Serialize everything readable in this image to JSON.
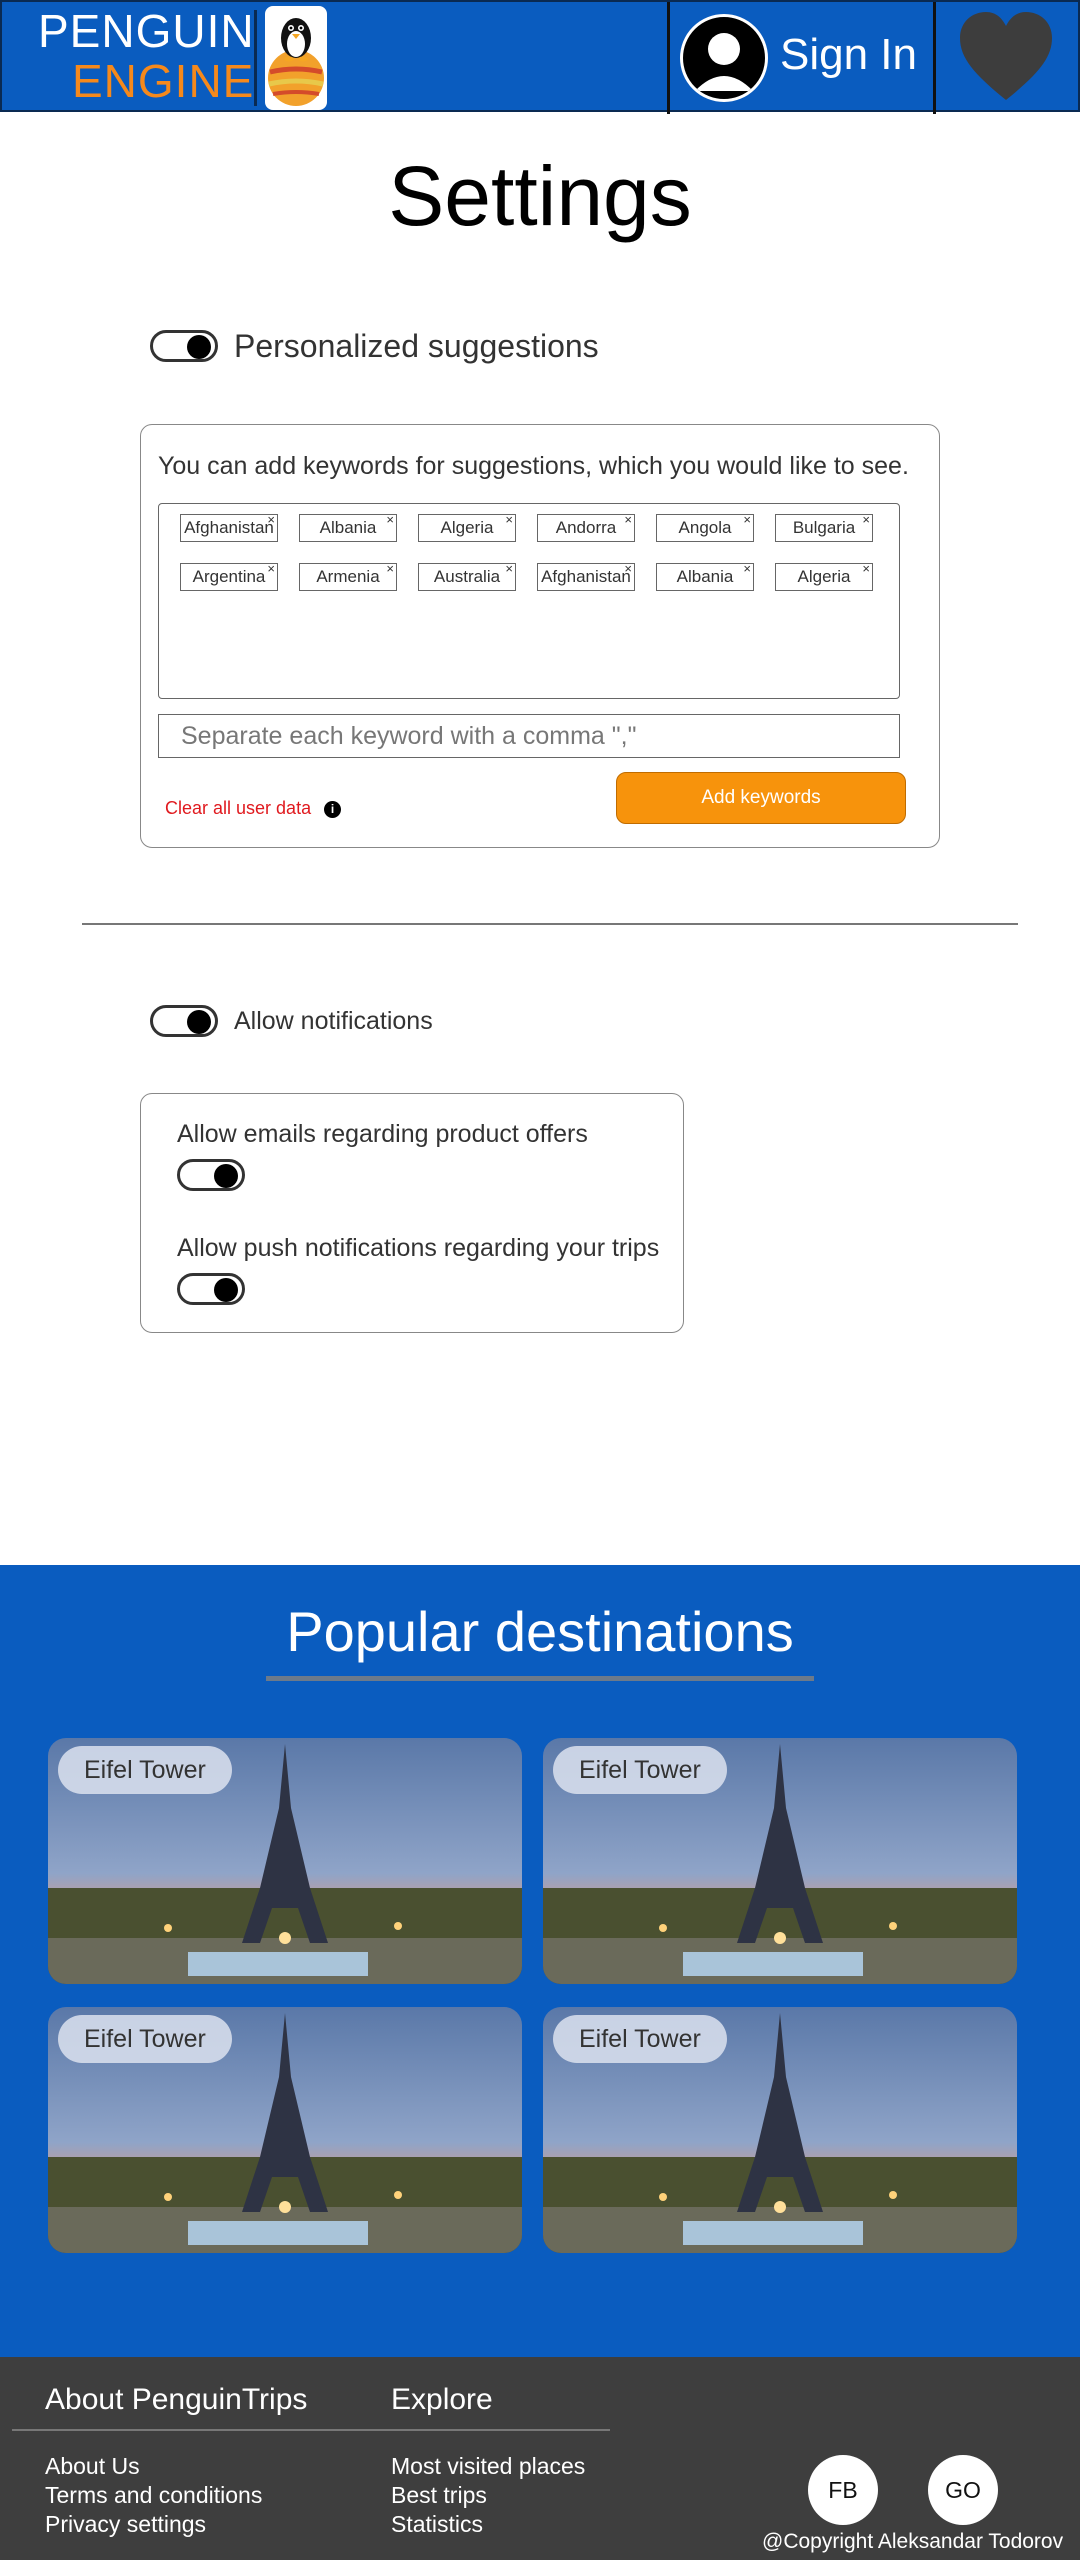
{
  "header": {
    "logo_line1": "PENGUIN",
    "logo_line2": "ENGINE",
    "sign_in": "Sign In",
    "brand_blue": "#0a5cbf",
    "brand_orange": "#f5891c",
    "icons": [
      "penguin-logo-icon",
      "user-avatar-icon",
      "heart-icon"
    ]
  },
  "page": {
    "title": "Settings"
  },
  "suggestions": {
    "toggle_label": "Personalized suggestions",
    "toggle_on": true,
    "hint": "You can add keywords for suggestions, which you would like to see.",
    "keywords": [
      "Afghanistan",
      "Albania",
      "Algeria",
      "Andorra",
      "Angola",
      "Bulgaria",
      "Argentina",
      "Armenia",
      "Australia",
      "Afghanistan",
      "Albania",
      "Algeria"
    ],
    "remove_glyph": "×",
    "input_placeholder": "Separate each keyword with a comma \",\"",
    "clear_link": "Clear all user data",
    "info_glyph": "i",
    "add_button": "Add keywords",
    "accent_orange": "#f7930c",
    "danger_red": "#e0191e"
  },
  "notifications": {
    "toggle_label": "Allow notifications",
    "toggle_on": true,
    "emails_label": "Allow emails regarding product offers",
    "emails_on": true,
    "push_label": "Allow push notifications regarding your trips",
    "push_on": true
  },
  "destinations": {
    "title": "Popular destinations",
    "cards": [
      {
        "label": "Eifel Tower"
      },
      {
        "label": "Eifel Tower"
      },
      {
        "label": "Eifel Tower"
      },
      {
        "label": "Eifel Tower"
      }
    ]
  },
  "footer": {
    "about_heading": "About PenguinTrips",
    "explore_heading": "Explore",
    "about_links": [
      "About Us",
      "Terms and conditions",
      "Privacy settings"
    ],
    "explore_links": [
      "Most visited places",
      "Best trips",
      "Statistics"
    ],
    "social": [
      "FB",
      "GO"
    ],
    "copyright": "@Copyright Aleksandar Todorov",
    "bg_color": "#3e3e3e"
  }
}
